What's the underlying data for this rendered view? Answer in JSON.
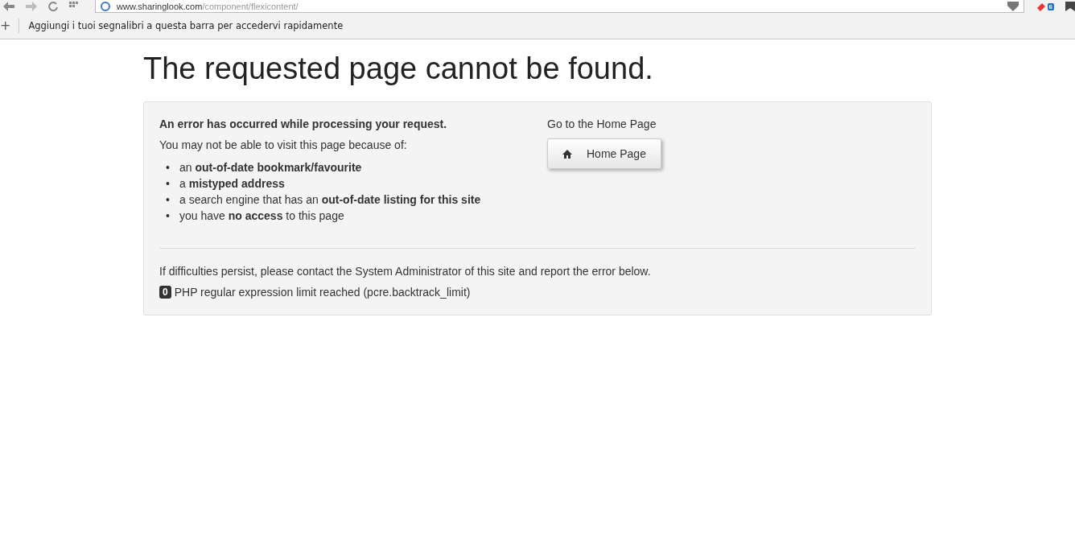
{
  "browser": {
    "url_host": "www.sharinglook.com",
    "url_path": "/component/flexicontent/",
    "extension_badge": "6",
    "add_bookmark": "+",
    "bookmarks_hint": "Aggiungi i tuoi segnalibri a questa barra per accedervi rapidamente"
  },
  "page": {
    "title": "The requested page cannot be found.",
    "error_heading": "An error has occurred while processing your request.",
    "intro": "You may not be able to visit this page because of:",
    "reasons": [
      {
        "bullet": "•",
        "text": "an **out-of-date bookmark/favourite**"
      },
      {
        "bullet": "•",
        "text": "a **mistyped address**"
      },
      {
        "bullet": "•",
        "text": "a search engine that has an **out-of-date listing for this site**"
      },
      {
        "bullet": "•",
        "text": "you have **no access** to this page"
      }
    ],
    "home_hint": "Go to the Home Page",
    "home_button": "Home Page",
    "contact": "If difficulties persist, please contact the System Administrator of this site and report the error below.",
    "error_code": "0",
    "error_message": "PHP regular expression limit reached (pcre.backtrack_limit)"
  }
}
